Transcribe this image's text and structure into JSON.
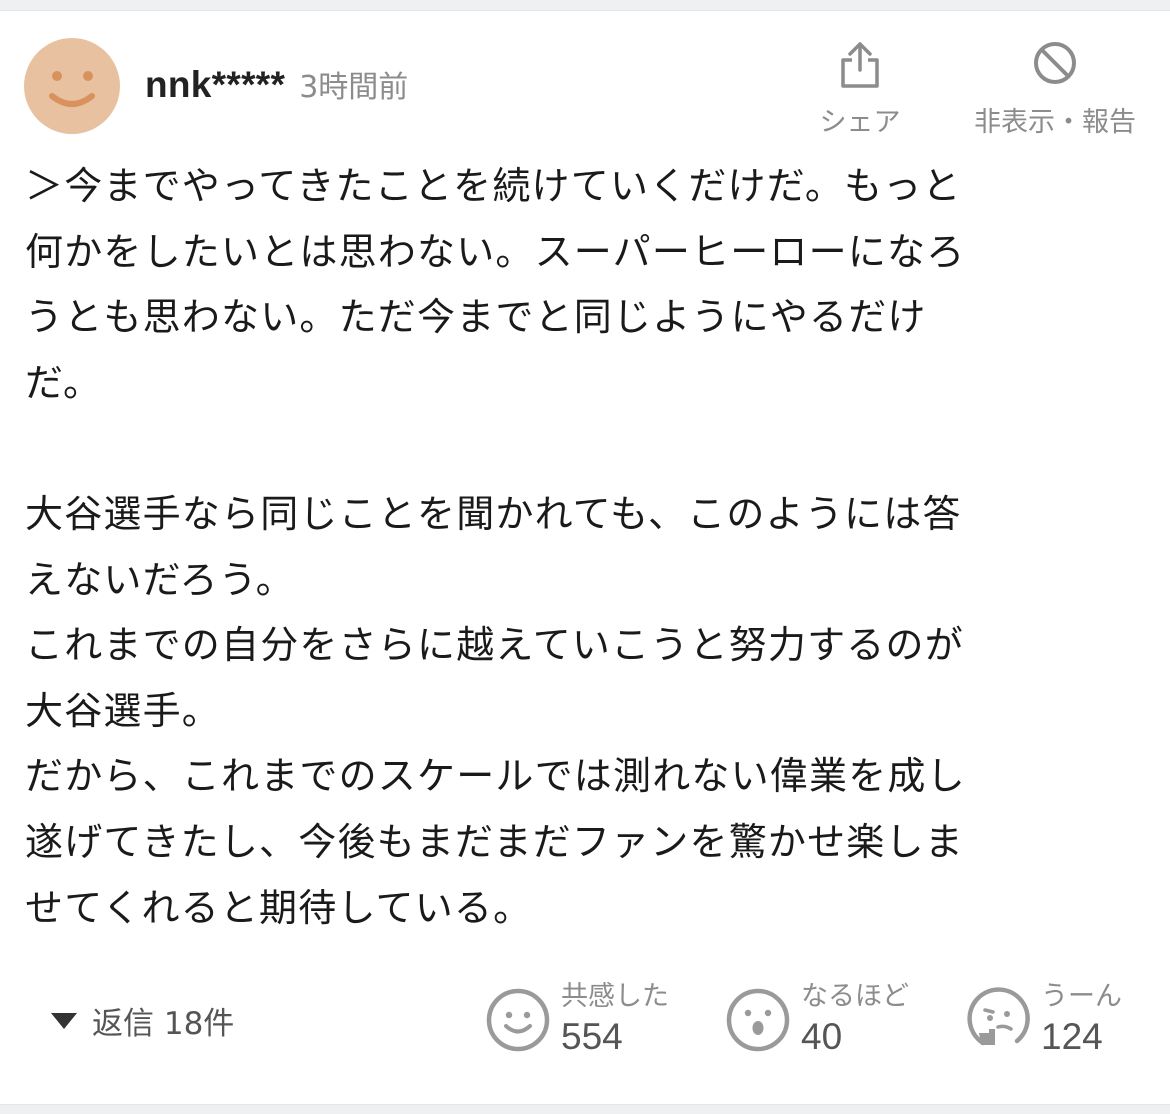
{
  "colors": {
    "avatar_bg": "#e8c2a0",
    "avatar_features": "#d9925e",
    "muted_text": "#8c8c8c",
    "icon_gray": "#9a9a9a",
    "body_text": "#1a1a1a"
  },
  "comment": {
    "username": "nnk*****",
    "timestamp": "3時間前",
    "avatar_icon": "smiley-face-icon",
    "lines": [
      "＞今までやってきたことを続けていくだけだ。もっと",
      "何かをしたいとは思わない。スーパーヒーローになろ",
      "うとも思わない。ただ今までと同じようにやるだけ",
      "だ。",
      "",
      "大谷選手なら同じことを聞かれても、このようには答",
      "えないだろう。",
      "これまでの自分をさらに越えていこうと努力するのが",
      "大谷選手。",
      "だから、これまでのスケールでは測れない偉業を成し",
      "遂げてきたし、今後もまだまだファンを驚かせ楽しま",
      "せてくれると期待している。"
    ]
  },
  "actions": {
    "share": {
      "label": "シェア",
      "icon": "share-icon"
    },
    "report": {
      "label": "非表示・報告",
      "icon": "block-icon"
    }
  },
  "replies": {
    "label": "返信 18件",
    "icon": "caret-down-icon"
  },
  "reactions": [
    {
      "label": "共感した",
      "count": "554",
      "icon": "smile-reaction-icon"
    },
    {
      "label": "なるほど",
      "count": "40",
      "icon": "surprised-reaction-icon"
    },
    {
      "label": "うーん",
      "count": "124",
      "icon": "thinking-reaction-icon"
    }
  ]
}
